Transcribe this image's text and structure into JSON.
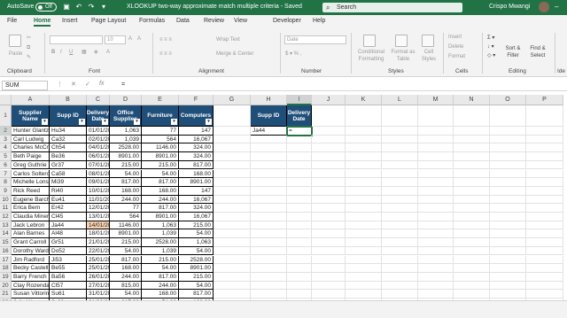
{
  "titlebar": {
    "autosave_label": "AutoSave",
    "autosave_state": "Off",
    "document_title": "XLOOKUP two-way approximate match multiple criteria  -  Saved",
    "search_placeholder": "Search",
    "user_name": "Crispo Mwangi",
    "accent_color": "#217346"
  },
  "tabs": [
    "File",
    "Home",
    "Insert",
    "Page Layout",
    "Formulas",
    "Data",
    "Review",
    "View",
    "Developer",
    "Help"
  ],
  "active_tab": "Home",
  "ribbon": {
    "groups": [
      "Clipboard",
      "Font",
      "Alignment",
      "Number",
      "Styles",
      "Cells",
      "Editing",
      "Ide"
    ],
    "paste_label": "Paste",
    "font_size": "10",
    "wrap_text": "Wrap Text",
    "merge_center": "Merge & Center",
    "number_format": "Date",
    "conditional_formatting": "Conditional Formatting",
    "format_as_table": "Format as Table",
    "cell_styles": "Cell Styles",
    "insert": "Insert",
    "delete": "Delete",
    "format": "Format",
    "sort_filter": "Sort & Filter",
    "find_select": "Find & Select"
  },
  "formula_bar": {
    "name_box": "SUM",
    "fx": "fx",
    "formula": "="
  },
  "columns": [
    "A",
    "B",
    "C",
    "D",
    "E",
    "F",
    "G",
    "H",
    "I",
    "J",
    "K",
    "L",
    "M",
    "N",
    "O",
    "P"
  ],
  "table": {
    "headers": [
      "Supplier Name",
      "Supp ID",
      "Delivery Date",
      "Office Supplies",
      "Furniture",
      "Computers"
    ],
    "rows": [
      [
        "Hunter Glantz",
        "Hu34",
        "01/01/2020",
        "1,063",
        "77",
        "147"
      ],
      [
        "Carl Ludwig",
        "Ca32",
        "02/01/2020",
        "1,039",
        "564",
        "16,067"
      ],
      [
        "Charles McCrossin",
        "Ch54",
        "04/01/2020",
        "2528.00",
        "1146.00",
        "324.00"
      ],
      [
        "Beth Paige",
        "Be36",
        "06/01/2020",
        "8901.00",
        "8901.00",
        "324.00"
      ],
      [
        "Greg Guthrie",
        "Gr37",
        "07/01/2020",
        "215.00",
        "215.00",
        "817.00"
      ],
      [
        "Carlos Soltero",
        "Ca58",
        "08/01/2020",
        "54.00",
        "54.00",
        "168.00"
      ],
      [
        "Michelle Lonsdale",
        "Mi39",
        "09/01/2020",
        "817.00",
        "817.00",
        "8901.00"
      ],
      [
        "Rick Reed",
        "Ri40",
        "10/01/2020",
        "168.00",
        "168.00",
        "147"
      ],
      [
        "Eugene Barchas",
        "Eu41",
        "11/01/2020",
        "244.00",
        "244.00",
        "16,067"
      ],
      [
        "Erica Bern",
        "Er42",
        "12/01/2020",
        "77",
        "817.00",
        "324.00"
      ],
      [
        "Claudia Miner",
        "Cl45",
        "13/01/2020",
        "564",
        "8901.00",
        "16,067"
      ],
      [
        "Jack Lebron",
        "Ja44",
        "14/01/2020",
        "1146.00",
        "1,063",
        "215.00"
      ],
      [
        "Alan Barnes",
        "Al48",
        "18/01/2020",
        "8901.00",
        "1,039",
        "54.00"
      ],
      [
        "Grant Carroll",
        "Gr51",
        "21/01/2020",
        "215.00",
        "2528.00",
        "1,063"
      ],
      [
        "Dorothy Wardle",
        "Do52",
        "22/01/2020",
        "54.00",
        "1,039",
        "54.00"
      ],
      [
        "Jim Radford",
        "Ji53",
        "25/01/2020",
        "817.00",
        "215.00",
        "2528.00"
      ],
      [
        "Becky Castell",
        "Be55",
        "25/01/2020",
        "168.00",
        "54.00",
        "8901.00"
      ],
      [
        "Barry French",
        "Ba56",
        "26/01/2020",
        "244.00",
        "817.00",
        "215.00"
      ],
      [
        "Clay Rozendal",
        "Cl57",
        "27/01/2020",
        "815.00",
        "244.00",
        "54.00"
      ],
      [
        "Susan Vittorini",
        "Su61",
        "31/01/2020",
        "54.00",
        "168.00",
        "817.00"
      ],
      [
        "Julia West",
        "Ju62",
        "01/02/2020",
        "817.00",
        "54.00",
        "168.00"
      ]
    ]
  },
  "lookup": {
    "header_supp_id": "Supp ID",
    "header_delivery_date": "Delivery Date",
    "supp_id_value": "Ja44",
    "input_value": "="
  },
  "row_numbers": [
    "1",
    "2",
    "3",
    "4",
    "5",
    "6",
    "7",
    "8",
    "9",
    "10",
    "11",
    "12",
    "13",
    "14",
    "15",
    "16",
    "17",
    "18",
    "19",
    "20",
    "21",
    "22"
  ]
}
